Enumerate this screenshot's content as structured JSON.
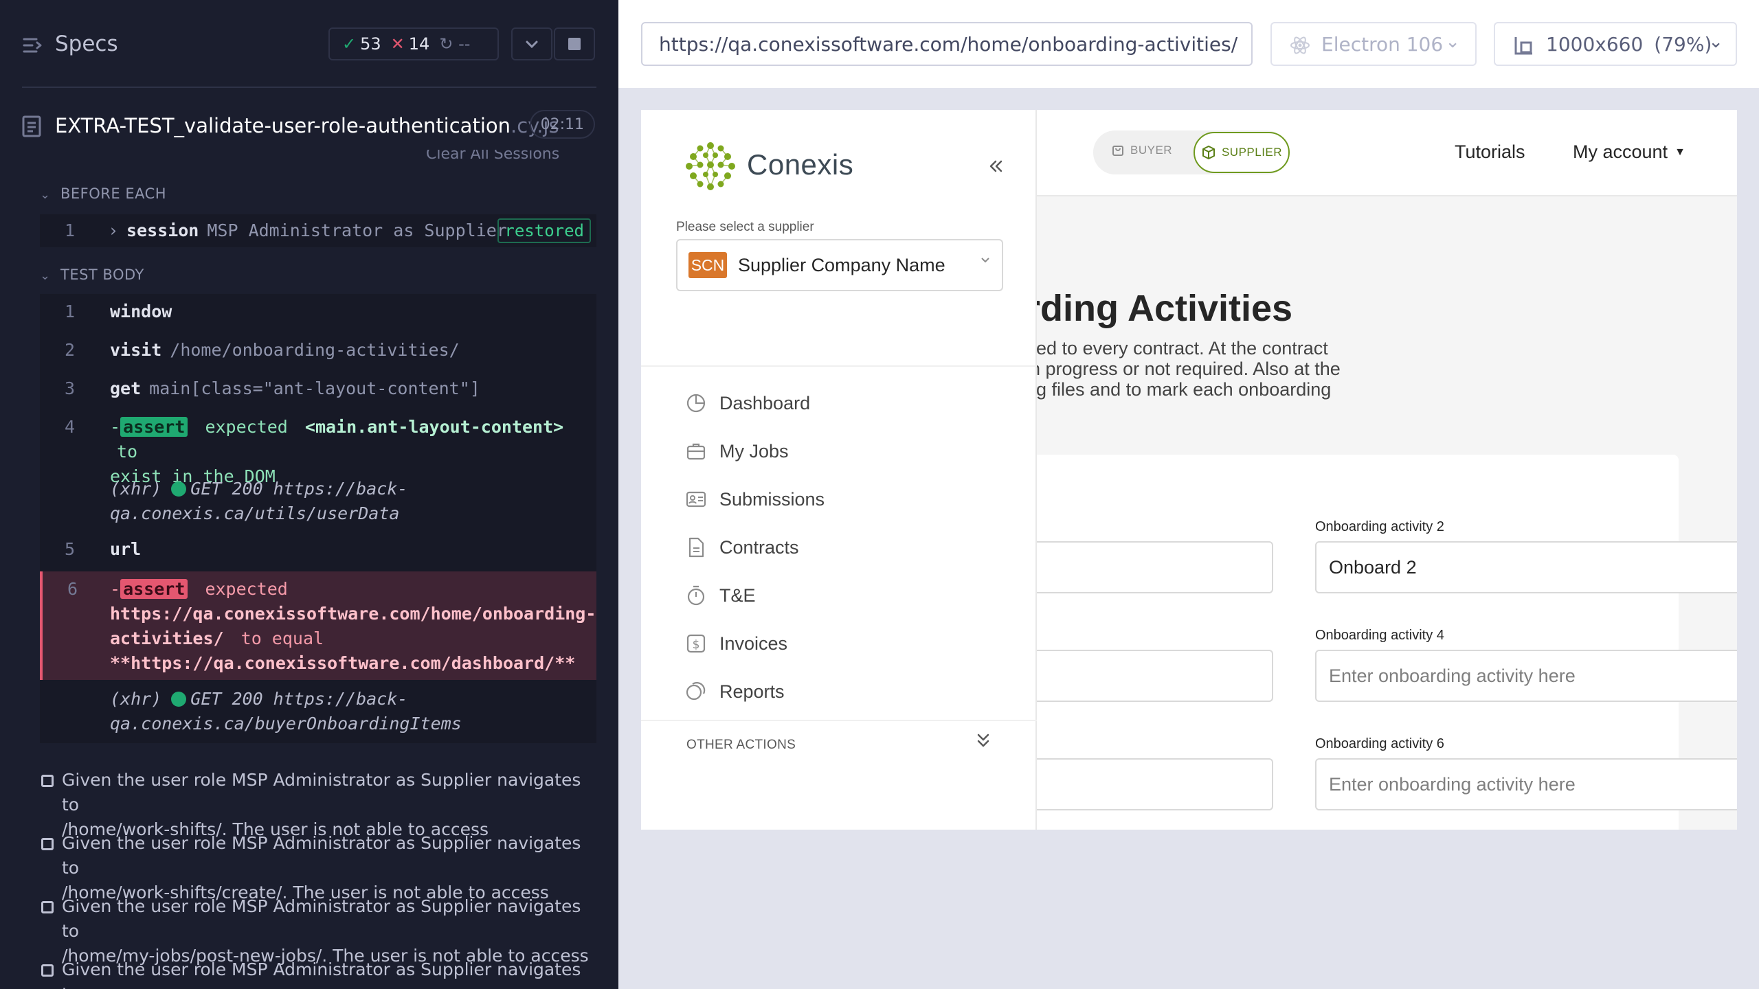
{
  "runner": {
    "header": {
      "title": "Specs",
      "passed": "53",
      "failed": "14",
      "pending": "--"
    },
    "spec": {
      "name": "EXTRA-TEST_validate-user-role-authentication",
      "ext": ".cy.js",
      "time": "02:11"
    },
    "clear_sessions": "Clear All Sessions",
    "before_each": {
      "label": "BEFORE EACH",
      "commands": [
        {
          "num": "1",
          "name": "session",
          "message": "MSP Administrator as Supplier",
          "badge": "restored"
        }
      ]
    },
    "test_body": {
      "label": "TEST BODY",
      "cmd1": {
        "num": "1",
        "name": "window"
      },
      "cmd2": {
        "num": "2",
        "name": "visit",
        "message": "/home/onboarding-activities/"
      },
      "cmd3": {
        "num": "3",
        "name": "get",
        "message": "main[class=\"ant-layout-content\"]"
      },
      "cmd4": {
        "num": "4",
        "prefix": "-",
        "name": "assert",
        "w1": "expected",
        "w2": "<main.ant-layout-content>",
        "w3": "to",
        "w4": "exist in the DOM"
      },
      "xhr1": {
        "label": "(xhr)",
        "line1": "GET 200 https://back-",
        "line2": "qa.conexis.ca/utils/userData"
      },
      "cmd5": {
        "num": "5",
        "name": "url"
      },
      "cmd6": {
        "num": "6",
        "prefix": "-",
        "name": "assert",
        "w1": "expected",
        "line2": "https://qa.conexissoftware.com/home/onboarding-",
        "line3a": "activities/",
        "line3b": "to equal",
        "line4": "**https://qa.conexissoftware.com/dashboard/**"
      },
      "xhr2": {
        "label": "(xhr)",
        "line1": "GET 200 https://back-",
        "line2": "qa.conexis.ca/buyerOnboardingItems"
      }
    },
    "pending_tests": [
      {
        "line1": "Given the user role MSP Administrator as Supplier navigates to",
        "line2": "/home/work-shifts/. The user is not able to access"
      },
      {
        "line1": "Given the user role MSP Administrator as Supplier navigates to",
        "line2": "/home/work-shifts/create/. The user is not able to access"
      },
      {
        "line1": "Given the user role MSP Administrator as Supplier navigates to",
        "line2": "/home/my-jobs/post-new-jobs/. The user is not able to access"
      },
      {
        "line1": "Given the user role MSP Administrator as Supplier navigates to",
        "line2": ""
      }
    ]
  },
  "aut": {
    "url": "https://qa.conexissoftware.com/home/onboarding-activities/",
    "browser": "Electron 106",
    "viewport": "1000x660",
    "zoom": "(79%)"
  },
  "app": {
    "logo_text": "Conexis",
    "supplier_select": {
      "label": "Please select a supplier",
      "badge": "SCN",
      "value": "Supplier Company Name"
    },
    "menu": [
      {
        "label": "Dashboard",
        "icon": "pie-chart-icon"
      },
      {
        "label": "My Jobs",
        "icon": "briefcase-icon"
      },
      {
        "label": "Submissions",
        "icon": "id-card-icon"
      },
      {
        "label": "Contracts",
        "icon": "document-icon"
      },
      {
        "label": "T&E",
        "icon": "stopwatch-icon"
      },
      {
        "label": "Invoices",
        "icon": "dollar-icon"
      },
      {
        "label": "Reports",
        "icon": "copy-icon"
      }
    ],
    "other_actions": "OTHER ACTIONS",
    "role_toggle": {
      "buyer": "BUYER",
      "supplier": "SUPPLIER"
    },
    "nav": {
      "tutorials": "Tutorials",
      "account": "My account"
    },
    "page_title": "rding Activities",
    "desc_lines": [
      "ded to every contract. At the contract",
      "in progress or not required. Also at the",
      "ng files and to mark each onboarding"
    ],
    "fields": [
      {
        "label": "Onboarding activity 2",
        "value": "Onboard 2"
      },
      {
        "label": "Onboarding activity 4",
        "placeholder": "Enter onboarding activity here"
      },
      {
        "label": "Onboarding activity 6",
        "placeholder": "Enter onboarding activity here"
      }
    ]
  },
  "colors": {
    "pass": "#1fa971",
    "fail": "#e45770",
    "brand_green": "#6f9a1f",
    "scn_badge": "#d9772b"
  }
}
